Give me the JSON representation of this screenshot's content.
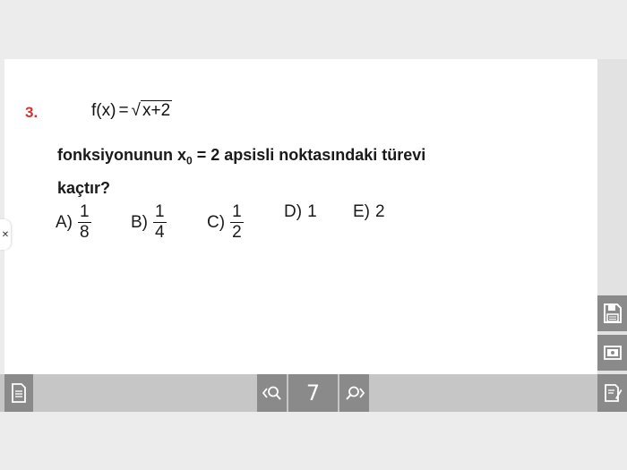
{
  "question": {
    "number": "3.",
    "formula": {
      "fx": "f(x)",
      "eq": "=",
      "radicand": "x+2"
    },
    "text_before": "fonksiyonunun  x",
    "subscript": "0",
    "text_after": " = 2  apsisli noktasındaki türevi",
    "text_line2": "kaçtır?"
  },
  "choices": [
    {
      "label": "A)",
      "numerator": "1",
      "denominator": "8"
    },
    {
      "label": "B)",
      "numerator": "1",
      "denominator": "4"
    },
    {
      "label": "C)",
      "numerator": "1",
      "denominator": "2"
    },
    {
      "label": "D)",
      "value": "1"
    },
    {
      "label": "E)",
      "value": "2"
    }
  ],
  "toolbar": {
    "page_number": "7"
  },
  "icons": {
    "save": "save-icon",
    "image": "image-icon",
    "notes": "notes-icon",
    "document": "document-icon",
    "prev_search": "prev-search-icon",
    "next_search": "next-search-icon",
    "close": "close-icon"
  },
  "colors": {
    "question_number": "#d0332f",
    "buttons": "#8a8a8a",
    "bar": "#c6c6c6"
  }
}
